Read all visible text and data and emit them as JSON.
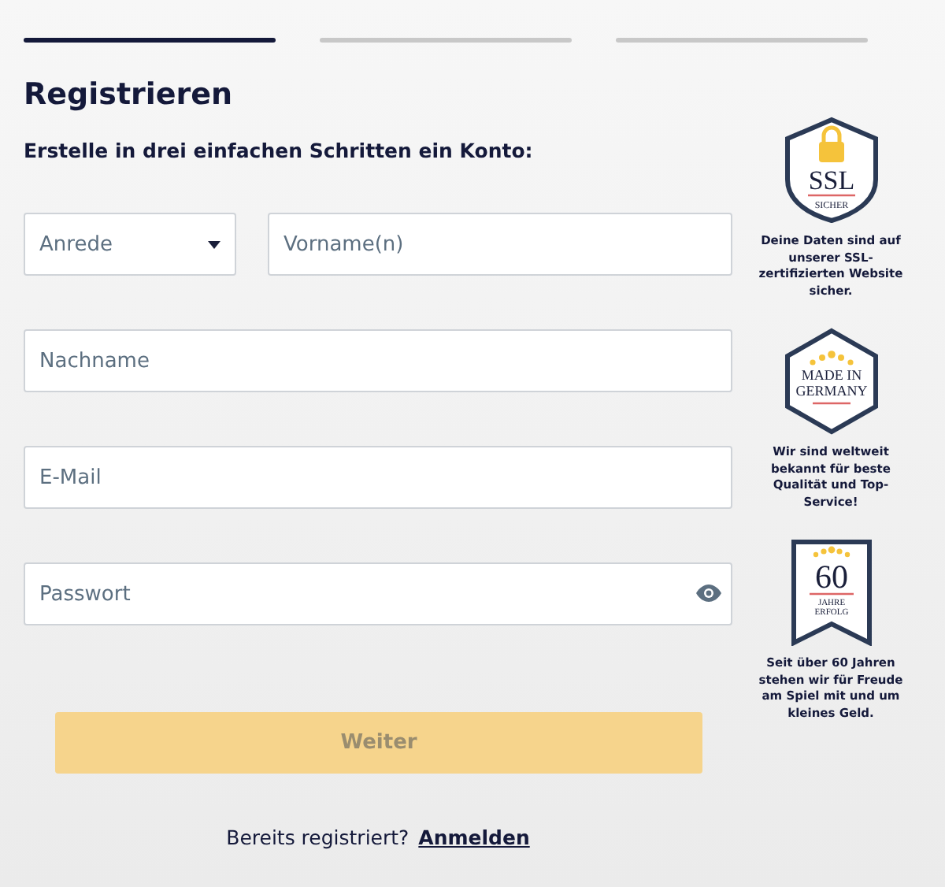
{
  "steps": [
    {
      "selected": true
    },
    {
      "selected": false
    },
    {
      "selected": false
    }
  ],
  "title": "Registrieren",
  "subtitle": "Erstelle in drei einfachen Schritten ein Konto:",
  "fields": [
    {
      "kind": "select",
      "placeholder": "Anrede"
    },
    {
      "kind": "text",
      "placeholder": "Vorname(n)"
    },
    {
      "kind": "text",
      "placeholder": "Nachname"
    },
    {
      "kind": "text",
      "placeholder": "E-Mail"
    },
    {
      "kind": "password",
      "placeholder": "Passwort"
    }
  ],
  "submit": {
    "label": "Weiter",
    "disabled": true
  },
  "footer": {
    "text": "Bereits registriert?",
    "link": "Anmelden"
  },
  "badges": [
    {
      "kind": "ssl",
      "lines": [
        "SSL",
        "SICHER"
      ],
      "caption": "Deine Daten sind auf unserer SSL-zertifizierten Website sicher."
    },
    {
      "kind": "germany",
      "lines": [
        "MADE IN",
        "GERMANY"
      ],
      "caption": "Wir sind weltweit bekannt für beste Qualität und Top-Service!"
    },
    {
      "kind": "years",
      "lines": [
        "60",
        "JAHRE",
        "ERFOLG"
      ],
      "caption": "Seit über 60 Jahren stehen wir für Freude am Spiel mit und um kleines Geld."
    }
  ]
}
